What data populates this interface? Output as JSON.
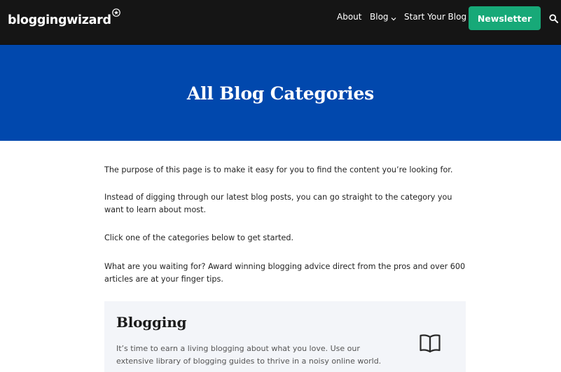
{
  "header": {
    "logo_text": "bloggingwizard",
    "nav": {
      "about": "About",
      "blog": "Blog",
      "start": "Start Your Blog"
    },
    "newsletter_label": "Newsletter"
  },
  "hero": {
    "title": "All Blog Categories"
  },
  "intro": {
    "p1": "The purpose of this page is to make it easy for you to find the content you’re looking for.",
    "p2": "Instead of digging through our latest blog posts, you can go straight to the category you want to learn about most.",
    "p3": "Click one of the categories below to get started.",
    "p4": "What are you waiting for? Award winning blogging advice direct from the pros and over 600 articles are at your finger tips."
  },
  "categories": [
    {
      "title": "Blogging",
      "description": "It’s time to earn a living blogging about what you love. Use our extensive library of blogging guides to thrive in a noisy online world.",
      "icon": "book-icon"
    }
  ],
  "colors": {
    "topbar": "#151515",
    "hero": "#0148ad",
    "newsletter": "#17a978",
    "card_bg": "#f3f5f9"
  }
}
